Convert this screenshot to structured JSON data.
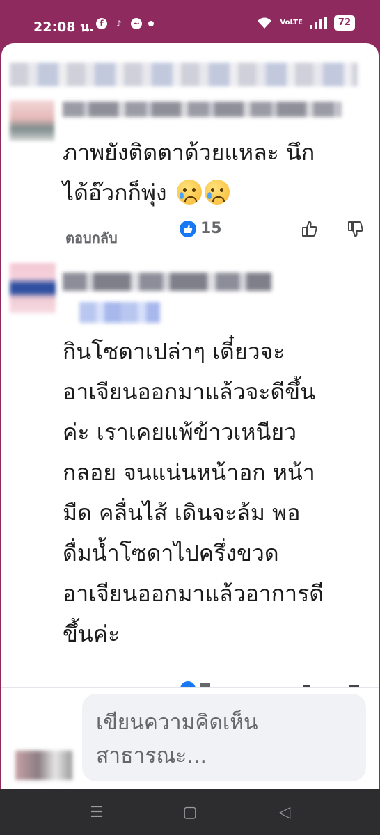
{
  "status_bar": {
    "time": "22:08 น.",
    "app_icons": [
      "facebook-icon",
      "tiktok-icon",
      "messenger-icon",
      "dot-icon"
    ],
    "network": "VoLTE",
    "battery": "72"
  },
  "comments": [
    {
      "text_line1": "ภาพยังติดตาด้วยแหละ นึก",
      "text_line2": "ได้อ๊วกก็พุ่ง",
      "emoji": [
        "crying-face-icon",
        "crying-face-icon"
      ],
      "reply_label": "ตอบกลับ",
      "like_count": "15"
    },
    {
      "lines": [
        "กินโซดาเปล่าๆ เดี๋ยวจะ",
        "อาเจียนออกมาแล้วจะดีขึ้น",
        "ค่ะ เราเคยแพ้ข้าวเหนียว",
        "กลอย จนแน่นหน้าอก หน้า",
        "มืด คลื่นไส้ เดินจะล้ม พอ",
        "ดื่มน้ำโซดาไปครึ่งขวด",
        "อาเจียนออกมาแล้วอาการดี",
        "ขึ้นค่ะ"
      ]
    }
  ],
  "composer": {
    "placeholder": "เขียนความคิดเห็นสาธารณะ..."
  },
  "colors": {
    "status_bar": "#8e2a5e",
    "like_blue": "#1877f2",
    "nav_bar": "#2d2d30"
  }
}
